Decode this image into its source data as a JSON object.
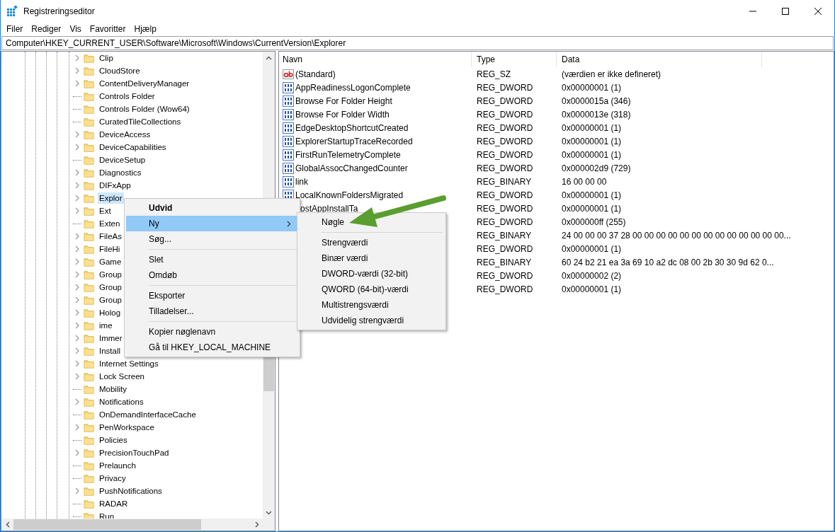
{
  "window": {
    "title": "Registreringseditor"
  },
  "menu_bar": [
    "Filer",
    "Rediger",
    "Vis",
    "Favoritter",
    "Hjælp"
  ],
  "address": "Computer\\HKEY_CURRENT_USER\\Software\\Microsoft\\Windows\\CurrentVersion\\Explorer",
  "tree": {
    "items": [
      {
        "label": "Clip",
        "expandable": true,
        "selected": false
      },
      {
        "label": "CloudStore",
        "expandable": true,
        "selected": false
      },
      {
        "label": "ContentDeliveryManager",
        "expandable": true,
        "selected": false
      },
      {
        "label": "Controls Folder",
        "expandable": false,
        "selected": false
      },
      {
        "label": "Controls Folder (Wow64)",
        "expandable": false,
        "selected": false
      },
      {
        "label": "CuratedTileCollections",
        "expandable": false,
        "selected": false
      },
      {
        "label": "DeviceAccess",
        "expandable": true,
        "selected": false
      },
      {
        "label": "DeviceCapabilities",
        "expandable": true,
        "selected": false
      },
      {
        "label": "DeviceSetup",
        "expandable": false,
        "selected": false
      },
      {
        "label": "Diagnostics",
        "expandable": true,
        "selected": false
      },
      {
        "label": "DIFxApp",
        "expandable": true,
        "selected": false
      },
      {
        "label": "Explor",
        "expandable": true,
        "selected": true
      },
      {
        "label": "Ext",
        "expandable": true,
        "selected": false
      },
      {
        "label": "Exten",
        "expandable": false,
        "selected": false
      },
      {
        "label": "FileAs",
        "expandable": true,
        "selected": false
      },
      {
        "label": "FileHi",
        "expandable": true,
        "selected": false
      },
      {
        "label": "Game",
        "expandable": true,
        "selected": false
      },
      {
        "label": "Group",
        "expandable": true,
        "selected": false
      },
      {
        "label": "Group",
        "expandable": true,
        "selected": false
      },
      {
        "label": "Group",
        "expandable": true,
        "selected": false
      },
      {
        "label": "Holog",
        "expandable": true,
        "selected": false
      },
      {
        "label": "ime",
        "expandable": true,
        "selected": false
      },
      {
        "label": "Immer",
        "expandable": true,
        "selected": false
      },
      {
        "label": "Install",
        "expandable": true,
        "selected": false
      },
      {
        "label": "Internet Settings",
        "expandable": true,
        "selected": false
      },
      {
        "label": "Lock Screen",
        "expandable": true,
        "selected": false
      },
      {
        "label": "Mobility",
        "expandable": false,
        "selected": false
      },
      {
        "label": "Notifications",
        "expandable": true,
        "selected": false
      },
      {
        "label": "OnDemandInterfaceCache",
        "expandable": false,
        "selected": false
      },
      {
        "label": "PenWorkspace",
        "expandable": true,
        "selected": false
      },
      {
        "label": "Policies",
        "expandable": false,
        "selected": false
      },
      {
        "label": "PrecisionTouchPad",
        "expandable": true,
        "selected": false
      },
      {
        "label": "Prelaunch",
        "expandable": false,
        "selected": false
      },
      {
        "label": "Privacy",
        "expandable": false,
        "selected": false
      },
      {
        "label": "PushNotifications",
        "expandable": true,
        "selected": false
      },
      {
        "label": "RADAR",
        "expandable": false,
        "selected": false
      },
      {
        "label": "Run",
        "expandable": false,
        "selected": false
      }
    ]
  },
  "values": {
    "columns": [
      "Navn",
      "Type",
      "Data"
    ],
    "rows": [
      {
        "kind": "string",
        "name": "(Standard)",
        "type": "REG_SZ",
        "data": "(værdien er ikke defineret)"
      },
      {
        "kind": "binary",
        "name": "AppReadinessLogonComplete",
        "type": "REG_DWORD",
        "data": "0x00000001 (1)"
      },
      {
        "kind": "binary",
        "name": "Browse For Folder Height",
        "type": "REG_DWORD",
        "data": "0x0000015a (346)"
      },
      {
        "kind": "binary",
        "name": "Browse For Folder Width",
        "type": "REG_DWORD",
        "data": "0x0000013e (318)"
      },
      {
        "kind": "binary",
        "name": "EdgeDesktopShortcutCreated",
        "type": "REG_DWORD",
        "data": "0x00000001 (1)"
      },
      {
        "kind": "binary",
        "name": "ExplorerStartupTraceRecorded",
        "type": "REG_DWORD",
        "data": "0x00000001 (1)"
      },
      {
        "kind": "binary",
        "name": "FirstRunTelemetryComplete",
        "type": "REG_DWORD",
        "data": "0x00000001 (1)"
      },
      {
        "kind": "binary",
        "name": "GlobalAssocChangedCounter",
        "type": "REG_DWORD",
        "data": "0x000002d9 (729)"
      },
      {
        "kind": "binary",
        "name": "link",
        "type": "REG_BINARY",
        "data": "16 00 00 00"
      },
      {
        "kind": "binary",
        "name": "LocalKnownFoldersMigrated",
        "type": "REG_DWORD",
        "data": "0x00000001 (1)"
      },
      {
        "name": "ostAppInstallTa",
        "type": "REG_DWORD",
        "data": "0x00000001 (1)"
      },
      {
        "type": "REG_DWORD",
        "data": "0x000000ff (255)"
      },
      {
        "type": "REG_BINARY",
        "data": "24 00 00 00 37 28 00 00 00 00 00 00 00 00 00 00 00 00 00..."
      },
      {
        "type": "REG_DWORD",
        "data": "0x00000001 (1)"
      },
      {
        "type": "REG_BINARY",
        "data": "60 24 b2 21 ea 3a 69 10 a2 dc 08 00 2b 30 30 9d 62 0..."
      },
      {
        "type": "REG_DWORD",
        "data": "0x00000002 (2)"
      },
      {
        "type": "REG_DWORD",
        "data": "0x00000001 (1)"
      }
    ]
  },
  "context_menu": {
    "items": [
      {
        "kind": "item",
        "label": "Udvid",
        "default": true,
        "selected": false,
        "submenu": false
      },
      {
        "kind": "item",
        "label": "Ny",
        "default": false,
        "selected": true,
        "submenu": true
      },
      {
        "kind": "item",
        "label": "Søg...",
        "default": false,
        "selected": false,
        "submenu": false
      },
      {
        "kind": "separator"
      },
      {
        "kind": "item",
        "label": "Slet",
        "default": false,
        "selected": false,
        "submenu": false
      },
      {
        "kind": "item",
        "label": "Omdøb",
        "default": false,
        "selected": false,
        "submenu": false
      },
      {
        "kind": "separator"
      },
      {
        "kind": "item",
        "label": "Eksporter",
        "default": false,
        "selected": false,
        "submenu": false
      },
      {
        "kind": "item",
        "label": "Tilladelser...",
        "default": false,
        "selected": false,
        "submenu": false
      },
      {
        "kind": "separator"
      },
      {
        "kind": "item",
        "label": "Kopier nøglenavn",
        "default": false,
        "selected": false,
        "submenu": false
      },
      {
        "kind": "item",
        "label": "Gå til HKEY_LOCAL_MACHINE",
        "default": false,
        "selected": false,
        "submenu": false
      }
    ]
  },
  "submenu": {
    "items": [
      {
        "kind": "item",
        "label": "Nøgle"
      },
      {
        "kind": "separator"
      },
      {
        "kind": "item",
        "label": "Strengværdi"
      },
      {
        "kind": "item",
        "label": "Binær værdi"
      },
      {
        "kind": "item",
        "label": "DWORD-værdi (32-bit)"
      },
      {
        "kind": "item",
        "label": "QWORD (64-bit)-værdi"
      },
      {
        "kind": "item",
        "label": "Multistrengsværdi"
      },
      {
        "kind": "item",
        "label": "Udvidelig strengværdi"
      }
    ]
  }
}
